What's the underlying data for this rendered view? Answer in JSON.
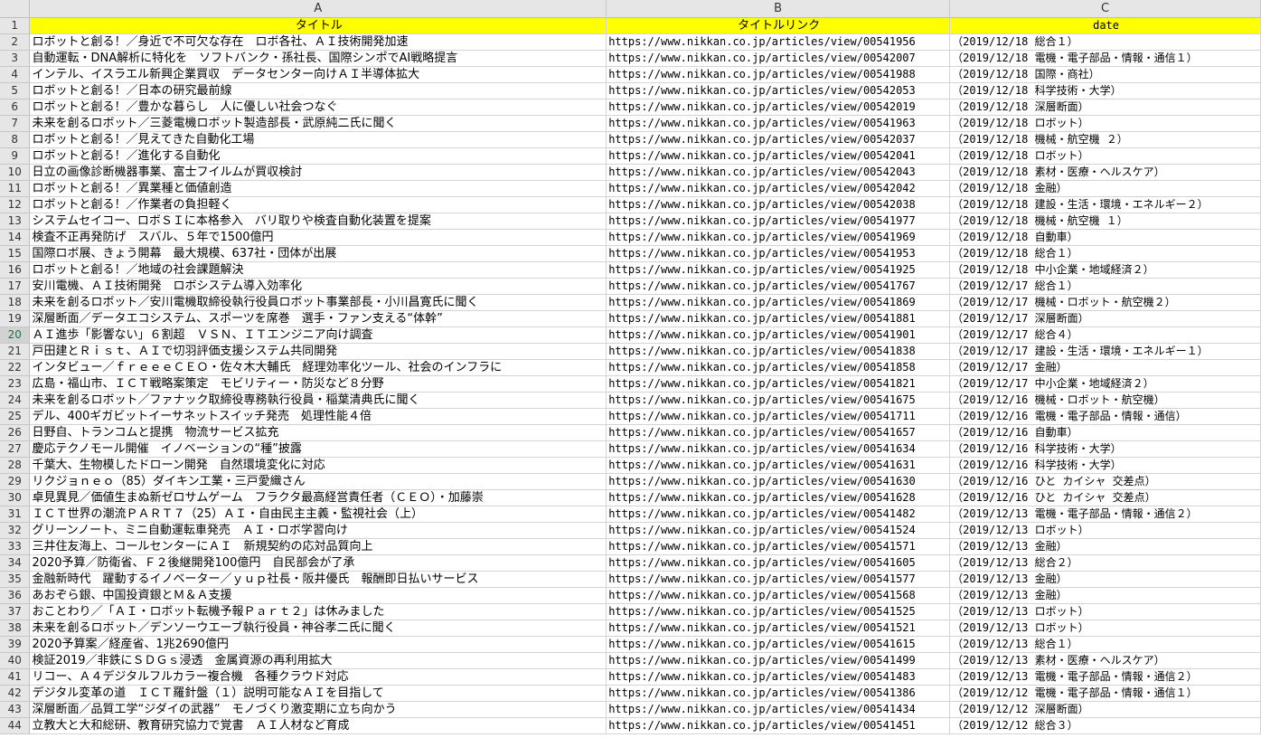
{
  "columns": [
    "A",
    "B",
    "C"
  ],
  "header": {
    "title": "タイトル",
    "link": "タイトルリンク",
    "date": "date"
  },
  "active_row": 20,
  "rows": [
    {
      "n": 2,
      "title": "ロボットと創る！／身近で不可欠な存在　ロボ各社、ＡＩ技術開発加速",
      "url": "https://www.nikkan.co.jp/articles/view/00541956",
      "date": "（2019/12/18 総合１）"
    },
    {
      "n": 3,
      "title": "自動運転・DNA解析に特化を　ソフトバンク・孫社長、国際シンポでAI戦略提言",
      "url": "https://www.nikkan.co.jp/articles/view/00542007",
      "date": "（2019/12/18 電機・電子部品・情報・通信１）"
    },
    {
      "n": 4,
      "title": "インテル、イスラエル新興企業買収　データセンター向けＡＩ半導体拡大",
      "url": "https://www.nikkan.co.jp/articles/view/00541988",
      "date": "（2019/12/18 国際・商社）"
    },
    {
      "n": 5,
      "title": "ロボットと創る！／日本の研究最前線",
      "url": "https://www.nikkan.co.jp/articles/view/00542053",
      "date": "（2019/12/18 科学技術・大学）"
    },
    {
      "n": 6,
      "title": "ロボットと創る！／豊かな暮らし　人に優しい社会つなぐ",
      "url": "https://www.nikkan.co.jp/articles/view/00542019",
      "date": "（2019/12/18 深層断面）"
    },
    {
      "n": 7,
      "title": "未来を創るロボット／三菱電機ロボット製造部長・武原純二氏に聞く",
      "url": "https://www.nikkan.co.jp/articles/view/00541963",
      "date": "（2019/12/18 ロボット）"
    },
    {
      "n": 8,
      "title": "ロボットと創る！／見えてきた自動化工場",
      "url": "https://www.nikkan.co.jp/articles/view/00542037",
      "date": "（2019/12/18 機械・航空機 ２）"
    },
    {
      "n": 9,
      "title": "ロボットと創る！／進化する自動化",
      "url": "https://www.nikkan.co.jp/articles/view/00542041",
      "date": "（2019/12/18 ロボット）"
    },
    {
      "n": 10,
      "title": "日立の画像診断機器事業、富士フイルムが買収検討",
      "url": "https://www.nikkan.co.jp/articles/view/00542043",
      "date": "（2019/12/18 素材・医療・ヘルスケア）"
    },
    {
      "n": 11,
      "title": "ロボットと創る！／異業種と価値創造",
      "url": "https://www.nikkan.co.jp/articles/view/00542042",
      "date": "（2019/12/18 金融）"
    },
    {
      "n": 12,
      "title": "ロボットと創る！／作業者の負担軽く",
      "url": "https://www.nikkan.co.jp/articles/view/00542038",
      "date": "（2019/12/18 建設・生活・環境・エネルギー２）"
    },
    {
      "n": 13,
      "title": "システムセイコー、ロボＳＩに本格参入　バリ取りや検査自動化装置を提案",
      "url": "https://www.nikkan.co.jp/articles/view/00541977",
      "date": "（2019/12/18 機械・航空機 １）"
    },
    {
      "n": 14,
      "title": "検査不正再発防げ　スバル、５年で1500億円",
      "url": "https://www.nikkan.co.jp/articles/view/00541969",
      "date": "（2019/12/18 自動車）"
    },
    {
      "n": 15,
      "title": "国際ロボ展、きょう開幕　最大規模、637社・団体が出展",
      "url": "https://www.nikkan.co.jp/articles/view/00541953",
      "date": "（2019/12/18 総合１）"
    },
    {
      "n": 16,
      "title": "ロボットと創る！／地域の社会課題解決",
      "url": "https://www.nikkan.co.jp/articles/view/00541925",
      "date": "（2019/12/18 中小企業・地域経済２）"
    },
    {
      "n": 17,
      "title": "安川電機、ＡＩ技術開発　ロボシステム導入効率化",
      "url": "https://www.nikkan.co.jp/articles/view/00541767",
      "date": "（2019/12/17 総合１）"
    },
    {
      "n": 18,
      "title": "未来を創るロボット／安川電機取締役執行役員ロボット事業部長・小川昌寛氏に聞く",
      "url": "https://www.nikkan.co.jp/articles/view/00541869",
      "date": "（2019/12/17 機械・ロボット・航空機２）"
    },
    {
      "n": 19,
      "title": "深層断面／データエコシステム、スポーツを席巻　選手・ファン支える“体幹”",
      "url": "https://www.nikkan.co.jp/articles/view/00541881",
      "date": "（2019/12/17 深層断面）"
    },
    {
      "n": 20,
      "title": "ＡＩ進歩「影響ない」６割超　ＶＳＮ、ＩＴエンジニア向け調査",
      "url": "https://www.nikkan.co.jp/articles/view/00541901",
      "date": "（2019/12/17 総合４）"
    },
    {
      "n": 21,
      "title": "戸田建とＲｉｓｔ、ＡＩで切羽評価支援システム共同開発",
      "url": "https://www.nikkan.co.jp/articles/view/00541838",
      "date": "（2019/12/17 建設・生活・環境・エネルギー１）"
    },
    {
      "n": 22,
      "title": "インタビュー／ｆｒｅｅｅＣＥＯ・佐々木大輔氏　経理効率化ツール、社会のインフラに",
      "url": "https://www.nikkan.co.jp/articles/view/00541858",
      "date": "（2019/12/17 金融）"
    },
    {
      "n": 23,
      "title": "広島・福山市、ＩＣＴ戦略案策定　モビリティー・防災など８分野",
      "url": "https://www.nikkan.co.jp/articles/view/00541821",
      "date": "（2019/12/17 中小企業・地域経済２）"
    },
    {
      "n": 24,
      "title": "未来を創るロボット／ファナック取締役専務執行役員・稲葉清典氏に聞く",
      "url": "https://www.nikkan.co.jp/articles/view/00541675",
      "date": "（2019/12/16 機械・ロボット・航空機）"
    },
    {
      "n": 25,
      "title": "デル、400ギガビットイーサネットスイッチ発売　処理性能４倍",
      "url": "https://www.nikkan.co.jp/articles/view/00541711",
      "date": "（2019/12/16 電機・電子部品・情報・通信）"
    },
    {
      "n": 26,
      "title": "日野自、トランコムと提携　物流サービス拡充",
      "url": "https://www.nikkan.co.jp/articles/view/00541657",
      "date": "（2019/12/16 自動車）"
    },
    {
      "n": 27,
      "title": "慶応テクノモール開催　イノベーションの“種”披露",
      "url": "https://www.nikkan.co.jp/articles/view/00541634",
      "date": "（2019/12/16 科学技術・大学）"
    },
    {
      "n": 28,
      "title": "千葉大、生物模したドローン開発　自然環境変化に対応",
      "url": "https://www.nikkan.co.jp/articles/view/00541631",
      "date": "（2019/12/16 科学技術・大学）"
    },
    {
      "n": 29,
      "title": "リクジョｎｅｏ（85）ダイキン工業・三戸愛織さん",
      "url": "https://www.nikkan.co.jp/articles/view/00541630",
      "date": "（2019/12/16 ひと カイシャ 交差点）"
    },
    {
      "n": 30,
      "title": "卓見異見／価値生まぬ新ゼロサムゲーム　フラクタ最高経営責任者（ＣＥＯ）・加藤崇",
      "url": "https://www.nikkan.co.jp/articles/view/00541628",
      "date": "（2019/12/16 ひと カイシャ 交差点）"
    },
    {
      "n": 31,
      "title": "ＩＣＴ世界の潮流ＰＡＲＴ７（25）ＡＩ・自由民主主義・監視社会（上）",
      "url": "https://www.nikkan.co.jp/articles/view/00541482",
      "date": "（2019/12/13 電機・電子部品・情報・通信２）"
    },
    {
      "n": 32,
      "title": "グリーンノート、ミニ自動運転車発売　ＡＩ・ロボ学習向け",
      "url": "https://www.nikkan.co.jp/articles/view/00541524",
      "date": "（2019/12/13 ロボット）"
    },
    {
      "n": 33,
      "title": "三井住友海上、コールセンターにＡＩ　新規契約の応対品質向上",
      "url": "https://www.nikkan.co.jp/articles/view/00541571",
      "date": "（2019/12/13 金融）"
    },
    {
      "n": 34,
      "title": "2020予算／防衛省、Ｆ２後継開発100億円　自民部会が了承",
      "url": "https://www.nikkan.co.jp/articles/view/00541605",
      "date": "（2019/12/13 総合２）"
    },
    {
      "n": 35,
      "title": "金融新時代　躍動するイノベーター／ｙｕｐ社長・阪井優氏　報酬即日払いサービス",
      "url": "https://www.nikkan.co.jp/articles/view/00541577",
      "date": "（2019/12/13 金融）"
    },
    {
      "n": 36,
      "title": "あおぞら銀、中国投資銀とＭ＆Ａ支援",
      "url": "https://www.nikkan.co.jp/articles/view/00541568",
      "date": "（2019/12/13 金融）"
    },
    {
      "n": 37,
      "title": "おことわり／「ＡＩ・ロボット転機予報Ｐａｒｔ２」は休みました",
      "url": "https://www.nikkan.co.jp/articles/view/00541525",
      "date": "（2019/12/13 ロボット）"
    },
    {
      "n": 38,
      "title": "未来を創るロボット／デンソーウエーブ執行役員・神谷孝二氏に聞く",
      "url": "https://www.nikkan.co.jp/articles/view/00541521",
      "date": "（2019/12/13 ロボット）"
    },
    {
      "n": 39,
      "title": "2020予算案／経産省、1兆2690億円",
      "url": "https://www.nikkan.co.jp/articles/view/00541615",
      "date": "（2019/12/13 総合１）"
    },
    {
      "n": 40,
      "title": "検証2019／非鉄にＳＤＧｓ浸透　金属資源の再利用拡大",
      "url": "https://www.nikkan.co.jp/articles/view/00541499",
      "date": "（2019/12/13 素材・医療・ヘルスケア）"
    },
    {
      "n": 41,
      "title": "リコー、Ａ４デジタルフルカラー複合機　各種クラウド対応",
      "url": "https://www.nikkan.co.jp/articles/view/00541483",
      "date": "（2019/12/13 電機・電子部品・情報・通信２）"
    },
    {
      "n": 42,
      "title": "デジタル変革の道　ＩＣＴ羅針盤（１）説明可能なＡＩを目指して",
      "url": "https://www.nikkan.co.jp/articles/view/00541386",
      "date": "（2019/12/12 電機・電子部品・情報・通信１）"
    },
    {
      "n": 43,
      "title": "深層断面／品質工学“ジダイの武器”　モノづくり激変期に立ち向かう",
      "url": "https://www.nikkan.co.jp/articles/view/00541434",
      "date": "（2019/12/12 深層断面）"
    },
    {
      "n": 44,
      "title": "立教大と大和総研、教育研究協力で覚書　ＡＩ人材など育成",
      "url": "https://www.nikkan.co.jp/articles/view/00541451",
      "date": "（2019/12/12 総合３）"
    }
  ]
}
